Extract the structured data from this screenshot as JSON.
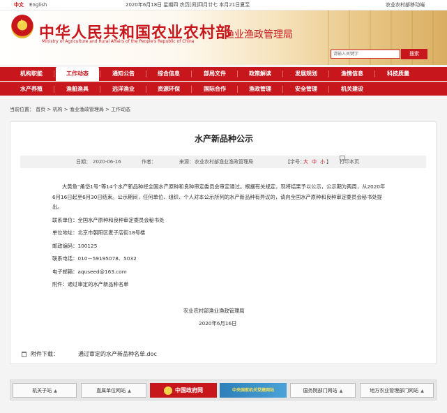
{
  "topbar": {
    "lang_cn": "中文",
    "lang_en": "English",
    "date_line": "2020年6月18日 星期四 农历[闰]四月廿七 本月21日夏至",
    "mobile": "农业农村部移动端"
  },
  "header": {
    "title": "中华人民共和国农业农村部",
    "subtitle": "Ministry of Agriculture  and  Rural  Affairs  of  the People's Republic of China",
    "bureau": "渔业渔政管理局",
    "search_placeholder": "请输入关键字",
    "search_button": "搜索"
  },
  "nav": {
    "row1": [
      "机构职能",
      "工作动态",
      "通知公告",
      "综合信息",
      "部局文件",
      "政策解读",
      "发展规划",
      "渔情信息",
      "科技质量"
    ],
    "row2": [
      "水产养殖",
      "渔船渔具",
      "远洋渔业",
      "资源环保",
      "国际合作",
      "渔政管理",
      "安全管理",
      "机关建设"
    ]
  },
  "breadcrumb": "当前位置：  首页  >  机构  >  渔业渔政管理局  >  工作动态",
  "article": {
    "title": "水产新品种公示",
    "date_label": "日期：",
    "date": "2020-06-16",
    "author_label": "作者：",
    "source_label": "来源：",
    "source": "农业农村部渔业渔政管理局",
    "font_label": "【字号：",
    "size_big": "大",
    "size_mid": "中",
    "size_small": "小",
    "font_close": "】",
    "print": "打印本页",
    "paragraph": "大黄鱼“甬岱1号”等14个水产新品种经全国水产原种和良种审定委员会审定通过。根据有关规定，现将结果予以公示，公示期为两周，从2020年6月16日起至6月30日结束。公示期间，任何单位、组织、个人对本公示所列的水产新品种有异议的，请向全国水产原种和良种审定委员会秘书处提出。",
    "lines": [
      "联系单位：全国水产原种和良种审定委员会秘书处",
      "单位地址：北京市朝阳区麦子店街18号楼",
      "邮政编码：100125",
      "联系电话：010－59195078、5032",
      "电子邮箱：aquseed@163.com",
      "附件：通过审定的水产新品种名单"
    ],
    "signature": "农业农村部渔业渔政管理局",
    "sign_date": "2020年6月16日"
  },
  "attachment": {
    "label": "附件下载：",
    "file": "通过审定的水产新品种名单.doc"
  },
  "footer": {
    "links": [
      "机关子站",
      "直属单位网站",
      "国务院部门网站",
      "地方农业管理部门网站"
    ],
    "gov_logo": "中国政府网",
    "party_logo": "中央国家机关党建网站"
  },
  "colors": {
    "brand_red": "#c8161d"
  }
}
